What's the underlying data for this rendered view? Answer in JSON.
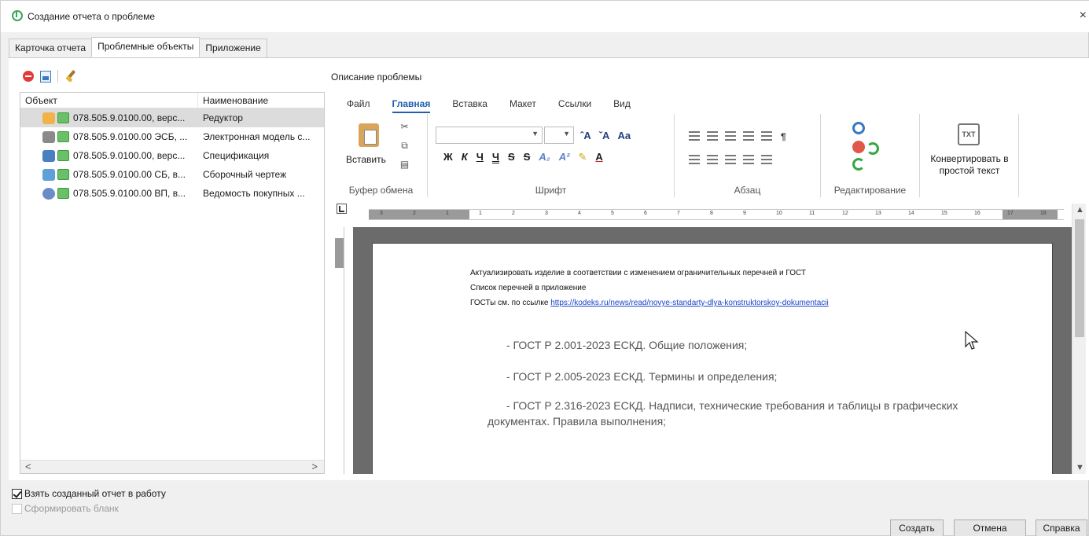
{
  "window": {
    "title": "Создание отчета о проблеме",
    "close_glyph": "×"
  },
  "tabs": [
    {
      "label": "Карточка отчета"
    },
    {
      "label": "Проблемные объекты"
    },
    {
      "label": "Приложение"
    }
  ],
  "left_toolbar": {
    "icons": [
      "remove-icon",
      "document-icon",
      "brush-icon"
    ]
  },
  "objects_table": {
    "columns": [
      "Объект",
      "Наименование"
    ],
    "rows": [
      {
        "object": "078.505.9.0100.00, верс...",
        "name": "Редуктор",
        "type_icon": "assembly-icon",
        "selected": true
      },
      {
        "object": "078.505.9.0100.00 ЭСБ, ...",
        "name": "Электронная модель с...",
        "type_icon": "model-icon",
        "selected": false
      },
      {
        "object": "078.505.9.0100.00, верс...",
        "name": "Спецификация",
        "type_icon": "specification-icon",
        "selected": false
      },
      {
        "object": "078.505.9.0100.00 СБ, в...",
        "name": "Сборочный чертеж",
        "type_icon": "drawing-icon",
        "selected": false
      },
      {
        "object": "078.505.9.0100.00 ВП, в...",
        "name": "Ведомость покупных ...",
        "type_icon": "purchase-list-icon",
        "selected": false
      }
    ],
    "scroll_left": "<",
    "scroll_right": ">"
  },
  "description": {
    "label": "Описание проблемы",
    "ribbon_tabs": [
      "Файл",
      "Главная",
      "Вставка",
      "Макет",
      "Ссылки",
      "Вид"
    ],
    "active_ribbon_tab": "Главная",
    "groups": {
      "clipboard": {
        "label": "Буфер обмена",
        "paste": "Вставить"
      },
      "font": {
        "label": "Шрифт",
        "font_name": "",
        "font_size": "",
        "top_buttons": [
          "ˆA",
          "ˇA",
          "Aa"
        ],
        "format_buttons": [
          "Ж",
          "К",
          "Ч",
          "Ч",
          "S",
          "S",
          "A₂",
          "A²",
          "✎",
          "A"
        ]
      },
      "paragraph": {
        "label": "Абзац",
        "pilcrow": "¶"
      },
      "editing": {
        "label": "Редактирование"
      },
      "convert": {
        "label": "Конвертировать в простой текст",
        "icon_text": "TXT"
      }
    },
    "ruler_numbers": [
      "3",
      "2",
      "1",
      "1",
      "2",
      "3",
      "4",
      "5",
      "6",
      "7",
      "8",
      "9",
      "10",
      "11",
      "12",
      "13",
      "14",
      "15",
      "16",
      "17",
      "18"
    ],
    "document": {
      "lines_small": [
        "Актуализировать изделие в соответствии с изменением ограничительных перечней и ГОСТ",
        "Список перечней в приложение"
      ],
      "link_prefix": "ГОСТы см. по ссылке ",
      "link": "https://kodeks.ru/news/read/novye-standarty-dlya-konstruktorskoy-dokumentacii",
      "lines_big": [
        "- ГОСТ Р 2.001-2023 ЕСКД. Общие положения;",
        "- ГОСТ Р 2.005-2023 ЕСКД. Термины и определения;",
        "- ГОСТ Р 2.316-2023 ЕСКД. Надписи, технические требования и таблицы в графических",
        "документах. Правила выполнения;"
      ]
    }
  },
  "checkboxes": [
    {
      "label": "Взять созданный отчет в работу",
      "checked": true,
      "enabled": true
    },
    {
      "label": "Сформировать бланк",
      "checked": false,
      "enabled": false
    }
  ],
  "buttons": {
    "create": "Создать",
    "cancel": "Отмена",
    "help": "Справка"
  }
}
